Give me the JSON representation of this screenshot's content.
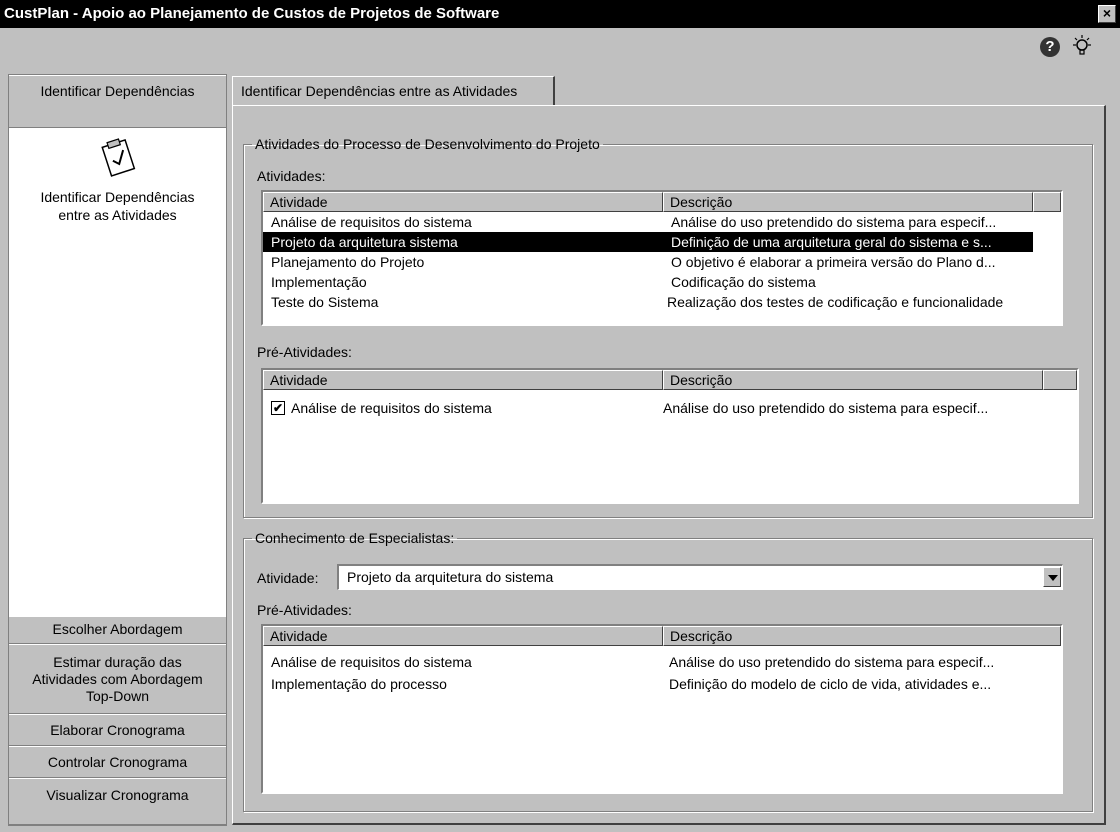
{
  "window": {
    "title": "CustPlan - Apoio ao Planejamento de Custos de Projetos de Software",
    "close_label": "×"
  },
  "toolbar": {
    "help_icon": "?",
    "tip_icon": "lightbulb-icon"
  },
  "sidebar": {
    "top_item": "Identificar Dependências",
    "sub_icon": "clipboard-check-icon",
    "sub_label_line1": "Identificar Dependências",
    "sub_label_line2": "entre as Atividades",
    "bottom_items": [
      {
        "lines": [
          "Escolher Abordagem"
        ]
      },
      {
        "lines": [
          "Estimar duração das",
          "Atividades com Abordagem",
          "Top-Down"
        ]
      },
      {
        "lines": [
          "Elaborar Cronograma"
        ]
      },
      {
        "lines": [
          "Controlar Cronograma"
        ]
      },
      {
        "lines": [
          "Visualizar Cronograma"
        ]
      }
    ]
  },
  "tab": {
    "label": "Identificar Dependências entre as Atividades"
  },
  "activities_group": {
    "legend": "Atividades do Processo de Desenvolvimento do Projeto",
    "activities_label": "Atividades:",
    "columns": [
      "Atividade",
      "Descrição"
    ],
    "rows": [
      {
        "activity": "Análise de requisitos do sistema",
        "description": "Análise do uso pretendido do sistema para especif..."
      },
      {
        "activity": "Projeto da arquitetura sistema",
        "description": "Definição de uma arquitetura geral do sistema e s...",
        "selected": true
      },
      {
        "activity": "Planejamento do Projeto",
        "description": "O objetivo é elaborar a primeira versão do Plano d..."
      },
      {
        "activity": "Implementação",
        "description": "Codificação do sistema"
      },
      {
        "activity": "Teste do Sistema",
        "description": "Realização dos testes de codificação e funcionalidade"
      }
    ],
    "pre_label": "Pré-Atividades:",
    "pre_columns": [
      "Atividade",
      "Descrição"
    ],
    "pre_rows": [
      {
        "activity": "Análise de requisitos do sistema",
        "description": "Análise do uso pretendido do sistema para especif...",
        "checked": true
      }
    ]
  },
  "experts_group": {
    "legend": "Conhecimento de Especialistas:",
    "activity_label": "Atividade:",
    "activity_value": "Projeto da arquitetura do sistema",
    "pre_label": "Pré-Atividades:",
    "columns": [
      "Atividade",
      "Descrição"
    ],
    "rows": [
      {
        "activity": "Análise de requisitos do sistema",
        "description": "Análise do uso pretendido do sistema para especif..."
      },
      {
        "activity": "Implementação do processo",
        "description": "Definição do modelo de ciclo de vida, atividades e..."
      }
    ]
  }
}
